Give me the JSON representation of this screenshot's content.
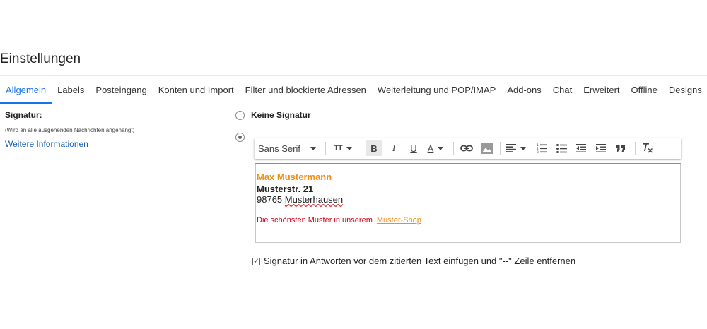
{
  "page": {
    "title": "Einstellungen"
  },
  "tabs": [
    {
      "label": "Allgemein",
      "active": true
    },
    {
      "label": "Labels"
    },
    {
      "label": "Posteingang"
    },
    {
      "label": "Konten und Import"
    },
    {
      "label": "Filter und blockierte Adressen"
    },
    {
      "label": "Weiterleitung und POP/IMAP"
    },
    {
      "label": "Add-ons"
    },
    {
      "label": "Chat"
    },
    {
      "label": "Erweitert"
    },
    {
      "label": "Offline"
    },
    {
      "label": "Designs"
    }
  ],
  "signature": {
    "label": "Signatur:",
    "sublabel": "(Wird an alle ausgehenden Nachrichten angehängt)",
    "more_info_link": "Weitere Informationen",
    "no_signature_option": "Keine Signatur",
    "selected_option": "custom"
  },
  "toolbar": {
    "font": "Sans Serif",
    "size_icon": "TT",
    "bold": "B",
    "italic": "I",
    "underline": "U",
    "text_color": "A",
    "icons": [
      "font-size-icon",
      "bold-icon",
      "italic-icon",
      "underline-icon",
      "text-color-icon",
      "link-icon",
      "image-icon",
      "align-icon",
      "numbered-list-icon",
      "bulleted-list-icon",
      "indent-less-icon",
      "indent-more-icon",
      "quote-icon",
      "remove-formatting-icon"
    ]
  },
  "editor": {
    "name": "Max Mustermann",
    "street_word": "Musterstr",
    "street_number": ". 21",
    "zip": "98765 ",
    "city": "Musterhausen",
    "promo_text": "Die schönsten Muster in unserem",
    "shop_link": "Muster-Shop"
  },
  "option": {
    "checked": true,
    "label": "Signatur in Antworten vor dem zitierten Text einfügen und \"--\" Zeile entfernen"
  },
  "colors": {
    "accent": "#1a73e8",
    "signature_name": "#f0901a",
    "promo": "#d0021b",
    "link": "#1a5fb4"
  }
}
